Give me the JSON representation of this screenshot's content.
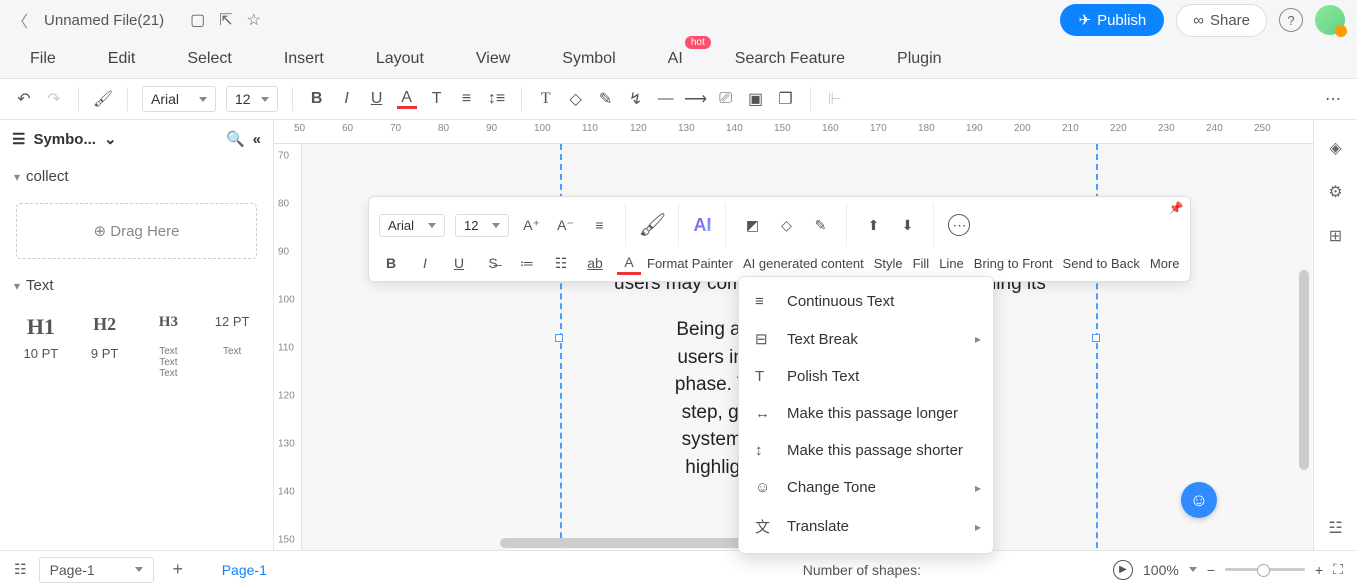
{
  "title_bar": {
    "filename": "Unnamed File(21)"
  },
  "top_actions": {
    "publish": "Publish",
    "share": "Share"
  },
  "menu": [
    "File",
    "Edit",
    "Select",
    "Insert",
    "Layout",
    "View",
    "Symbol",
    "AI",
    "Search Feature",
    "Plugin"
  ],
  "hot_badge": "hot",
  "toolbar": {
    "font": "Arial",
    "size": "12"
  },
  "sidebar": {
    "title": "Symbo...",
    "sections": {
      "collect": "collect",
      "text": "Text"
    },
    "drag_here": "Drag Here",
    "text_items": {
      "h1": "H1",
      "h2": "H2",
      "h3": "H3",
      "pt12": "12 PT",
      "pt10": "10 PT",
      "pt9": "9 PT",
      "stack": "Text\nText\nText",
      "single": "Text"
    }
  },
  "ruler_h": [
    "50",
    "60",
    "70",
    "80",
    "90",
    "100",
    "110",
    "120",
    "130",
    "140",
    "150",
    "160",
    "170",
    "180",
    "190",
    "200",
    "210",
    "220",
    "230",
    "240",
    "250"
  ],
  "ruler_v": [
    "70",
    "80",
    "90",
    "100",
    "110",
    "120",
    "130",
    "140",
    "150"
  ],
  "doc_text": {
    "line1": "users may come across variant issues regarding its",
    "para": "Being an unstable [redacted] puts its\nusers in an exasp[redacted] unching\nphase. The Uplay [redacted] unching\nstep, given the va[redacted] of both\nsystem & applicat[redacted] e been\nhighlighted in the[redacted] iece of"
  },
  "floating_tb": {
    "font": "Arial",
    "size": "12",
    "labels": {
      "format": "Format Painter",
      "ai": "AI generated content",
      "style": "Style",
      "fill": "Fill",
      "line": "Line",
      "front": "Bring to Front",
      "back": "Send to Back",
      "more": "More"
    }
  },
  "ai_menu": [
    {
      "icon": "≡",
      "label": "Continuous Text",
      "sub": false
    },
    {
      "icon": "⊟",
      "label": "Text Break",
      "sub": true
    },
    {
      "icon": "T",
      "label": "Polish Text",
      "sub": false
    },
    {
      "icon": "↔",
      "label": "Make this passage longer",
      "sub": false
    },
    {
      "icon": "↕",
      "label": "Make this passage shorter",
      "sub": false
    },
    {
      "icon": "☺",
      "label": "Change Tone",
      "sub": true
    },
    {
      "icon": "文",
      "label": "Translate",
      "sub": true
    }
  ],
  "bottom": {
    "page_select": "Page-1",
    "active_page": "Page-1",
    "shapes": "Number of shapes: ",
    "zoom": "100%"
  }
}
